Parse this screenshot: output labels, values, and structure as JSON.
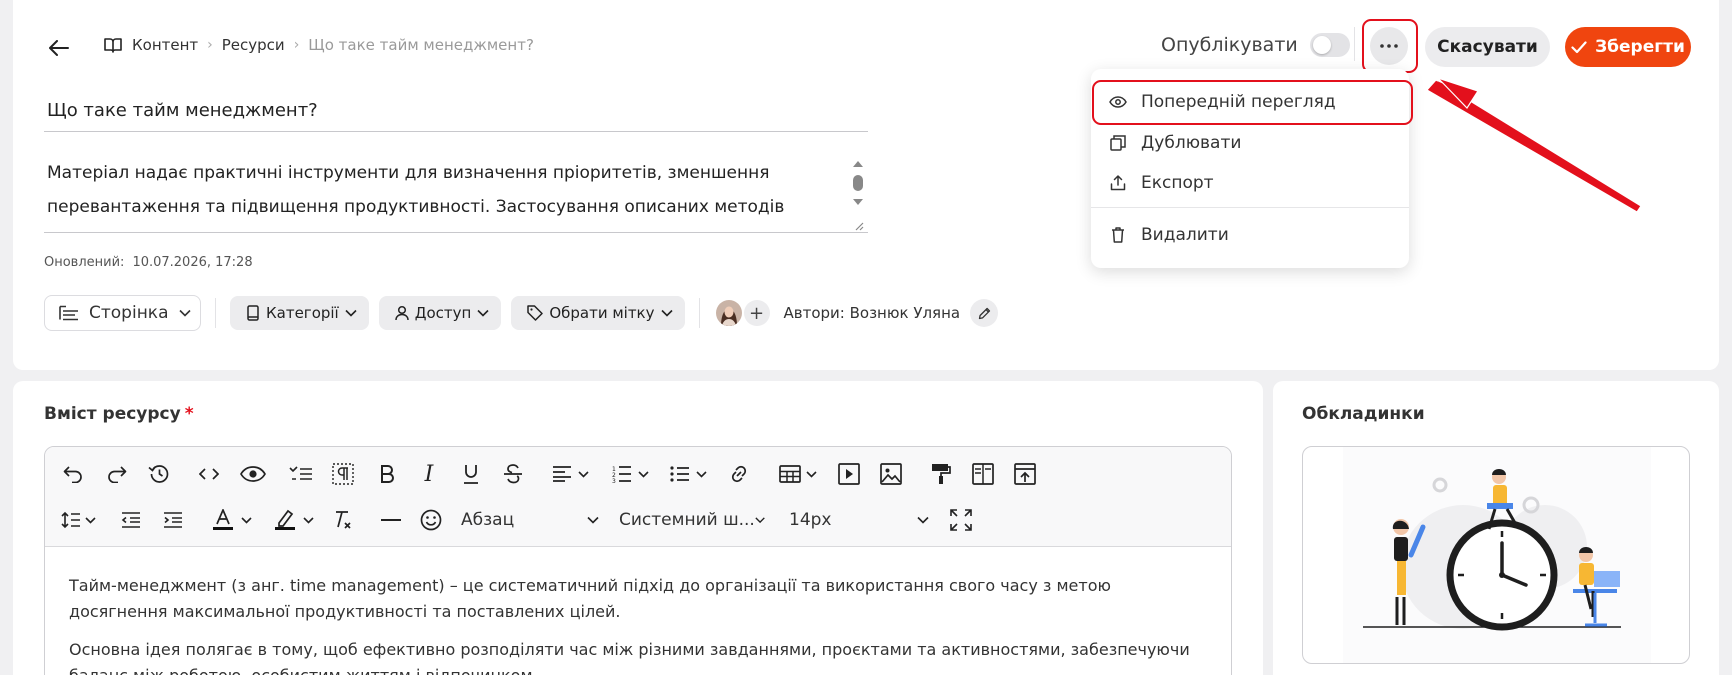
{
  "header": {
    "breadcrumb": [
      "Контент",
      "Ресурси",
      "Що таке тайм менеджмент?"
    ],
    "publish_label": "Опублікувати",
    "cancel_label": "Скасувати",
    "save_label": "Зберегти"
  },
  "menu": {
    "items": [
      {
        "label": "Попередній перегляд",
        "icon": "eye-icon"
      },
      {
        "label": "Дублювати",
        "icon": "copy-icon"
      },
      {
        "label": "Експорт",
        "icon": "export-icon"
      },
      {
        "label": "Видалити",
        "icon": "trash-icon"
      }
    ]
  },
  "resource": {
    "title": "Що таке тайм менеджмент?",
    "description_lines": [
      "Матеріал надає практичні інструменти для визначення пріоритетів, зменшення",
      "перевантаження та підвищення продуктивності. Застосування описаних методів"
    ],
    "updated_label": "Оновлений:",
    "updated_value": "10.07.2026, 17:28"
  },
  "meta": {
    "page_type": "Сторінка",
    "categories": "Категорії",
    "access": "Доступ",
    "tag": "Обрати мітку",
    "authors": "Автори: Вознюк Уляна"
  },
  "content": {
    "section_title": "Вміст ресурсу",
    "required_mark": "*",
    "format": "Абзац",
    "font": "Системний ш...",
    "font_size": "14px",
    "paragraphs": [
      "Тайм-менеджмент (з анг. time management) – це систематичний підхід до організації та використання свого часу з метою досягнення максимальної продуктивності та поставлених цілей.",
      "Основна ідея полягає в тому, щоб ефективно розподіляти час між різними завданнями, проєктами та активностями, забезпечуючи баланс між роботою, особистим життям і відпочинком."
    ]
  },
  "covers": {
    "section_title": "Обкладинки"
  },
  "colors": {
    "accent": "#f0450f",
    "highlight": "#e3101c"
  }
}
